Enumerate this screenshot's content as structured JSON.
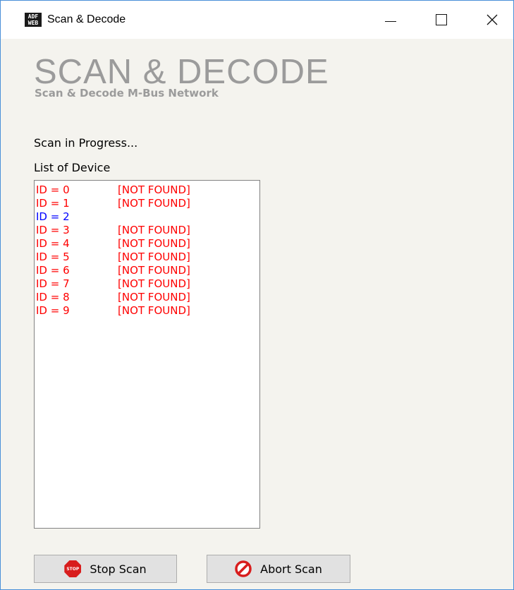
{
  "window": {
    "title": "Scan & Decode",
    "app_icon_text": "ADF WEB"
  },
  "header": {
    "title": "SCAN & DECODE",
    "subtitle": "Scan & Decode M-Bus Network"
  },
  "status_text": "Scan in Progress...",
  "list_label": "List of Device",
  "devices": [
    {
      "id": "ID = 0",
      "status": "[NOT FOUND]",
      "color": "#ff0000"
    },
    {
      "id": "ID = 1",
      "status": "[NOT FOUND]",
      "color": "#ff0000"
    },
    {
      "id": "ID = 2",
      "status": "",
      "color": "#0000ff"
    },
    {
      "id": "ID = 3",
      "status": "[NOT FOUND]",
      "color": "#ff0000"
    },
    {
      "id": "ID = 4",
      "status": "[NOT FOUND]",
      "color": "#ff0000"
    },
    {
      "id": "ID = 5",
      "status": "[NOT FOUND]",
      "color": "#ff0000"
    },
    {
      "id": "ID = 6",
      "status": "[NOT FOUND]",
      "color": "#ff0000"
    },
    {
      "id": "ID = 7",
      "status": "[NOT FOUND]",
      "color": "#ff0000"
    },
    {
      "id": "ID = 8",
      "status": "[NOT FOUND]",
      "color": "#ff0000"
    },
    {
      "id": "ID = 9",
      "status": "[NOT FOUND]",
      "color": "#ff0000"
    }
  ],
  "buttons": {
    "stop": {
      "label": "Stop Scan",
      "icon": "stop-sign-icon",
      "icon_text": "STOP"
    },
    "abort": {
      "label": "Abort Scan",
      "icon": "prohibited-icon"
    }
  },
  "colors": {
    "heading": "#9b9b9b",
    "window_bg": "#f4f3ee",
    "not_found": "#ff0000",
    "found": "#0000ff"
  }
}
